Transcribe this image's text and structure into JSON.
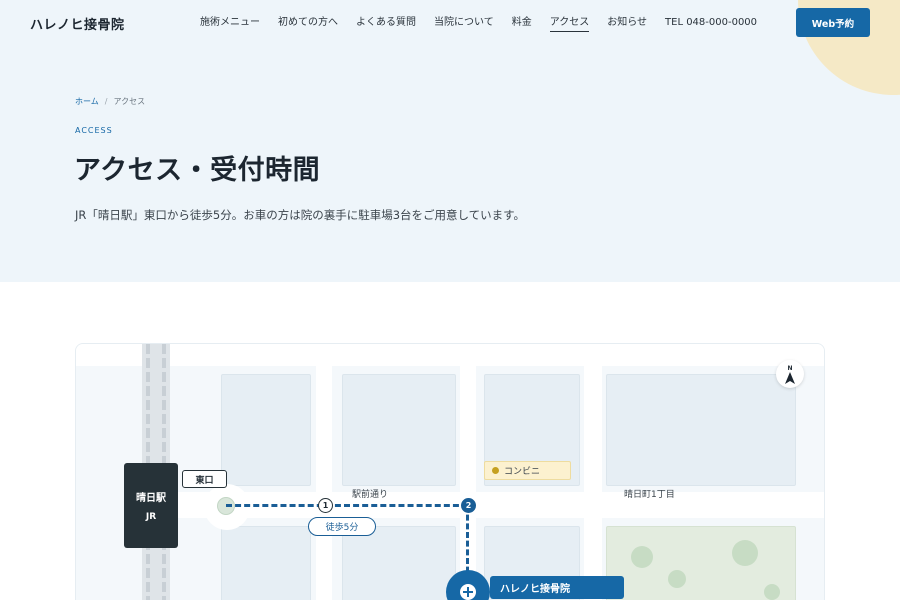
{
  "header": {
    "logo": "ハレノヒ接骨院",
    "nav": [
      {
        "label": "施術メニュー"
      },
      {
        "label": "初めての方へ"
      },
      {
        "label": "よくある質問"
      },
      {
        "label": "当院について"
      },
      {
        "label": "料金"
      },
      {
        "label": "アクセス"
      },
      {
        "label": "お知らせ"
      }
    ],
    "tel": "TEL 048-000-0000",
    "cta": "Web予約"
  },
  "hero": {
    "breadcrumb": {
      "home": "ホーム",
      "separator": "/",
      "current": "アクセス"
    },
    "eyebrow": "ACCESS",
    "title": "アクセス・受付時間",
    "lead": "JR「晴日駅」東口から徒歩5分。お車の方は院の裏手に駐車場3台をご用意しています。"
  },
  "map": {
    "station_name": "晴日駅",
    "station_line": "JR",
    "exit_label": "東口",
    "step1": "1",
    "step2": "2",
    "walk_time": "徒歩5分",
    "street_main": "駅前通り",
    "street_town": "晴日町1丁目",
    "convenience_store": "コンビニ",
    "compass_north": "N",
    "clinic_name": "ハレノヒ接骨院"
  },
  "colors": {
    "brand": "#1668a6",
    "hero_bg": "#eef5fa",
    "accent_circle": "#f5e9c6",
    "station_bg": "#263238"
  }
}
